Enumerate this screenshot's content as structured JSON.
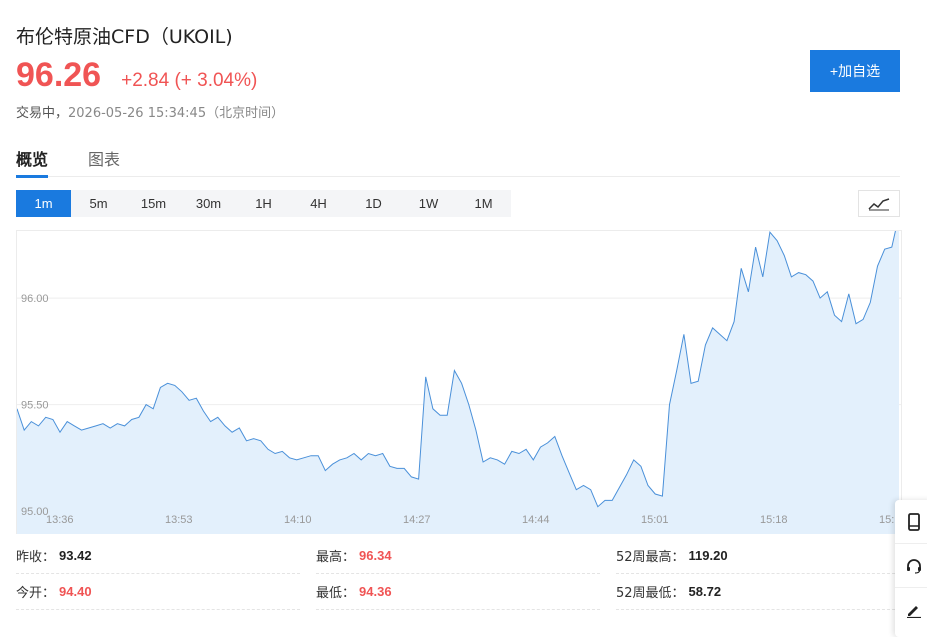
{
  "header": {
    "title": "布伦特原油CFD（UKOIL)",
    "price": "96.26",
    "change": "+2.84  (+ 3.04%)",
    "status_state": "交易中，",
    "status_time": "2026-05-26 15:34:45（北京时间）"
  },
  "actions": {
    "add_watchlist": "+加自选"
  },
  "tabs": [
    {
      "label": "概览",
      "active": true
    },
    {
      "label": "图表",
      "active": false
    }
  ],
  "intervals": [
    {
      "label": "1m",
      "active": true
    },
    {
      "label": "5m",
      "active": false
    },
    {
      "label": "15m",
      "active": false
    },
    {
      "label": "30m",
      "active": false
    },
    {
      "label": "1H",
      "active": false
    },
    {
      "label": "4H",
      "active": false
    },
    {
      "label": "1D",
      "active": false
    },
    {
      "label": "1W",
      "active": false
    },
    {
      "label": "1M",
      "active": false
    }
  ],
  "icons": {
    "chart_type": "line-chart-icon",
    "side": [
      "mobile-icon",
      "headset-icon",
      "pen-icon"
    ]
  },
  "colors": {
    "accent": "#1a7adf",
    "up": "#f05454",
    "line": "#4a90d9",
    "area": "#e3f0fc"
  },
  "chart_data": {
    "type": "area",
    "x_tick_labels": [
      "13:36",
      "13:53",
      "14:10",
      "14:27",
      "14:44",
      "15:01",
      "15:18",
      "15:"
    ],
    "y_tick_labels": [
      "96.00",
      "95.50",
      "95.00"
    ],
    "y_ticks": [
      96.0,
      95.5,
      95.0
    ],
    "ylim": [
      95.0,
      96.4
    ],
    "values": [
      95.48,
      95.38,
      95.42,
      95.4,
      95.44,
      95.43,
      95.37,
      95.42,
      95.4,
      95.38,
      95.39,
      95.4,
      95.41,
      95.39,
      95.41,
      95.4,
      95.43,
      95.44,
      95.5,
      95.48,
      95.58,
      95.6,
      95.59,
      95.56,
      95.52,
      95.53,
      95.47,
      95.42,
      95.44,
      95.4,
      95.37,
      95.39,
      95.33,
      95.34,
      95.33,
      95.29,
      95.27,
      95.28,
      95.25,
      95.24,
      95.25,
      95.26,
      95.26,
      95.19,
      95.22,
      95.24,
      95.25,
      95.27,
      95.24,
      95.27,
      95.26,
      95.27,
      95.21,
      95.2,
      95.2,
      95.16,
      95.15,
      95.63,
      95.48,
      95.45,
      95.45,
      95.66,
      95.6,
      95.5,
      95.38,
      95.23,
      95.25,
      95.24,
      95.22,
      95.28,
      95.27,
      95.29,
      95.24,
      95.3,
      95.32,
      95.35,
      95.26,
      95.18,
      95.1,
      95.12,
      95.1,
      95.02,
      95.05,
      95.05,
      95.11,
      95.17,
      95.24,
      95.21,
      95.12,
      95.08,
      95.07,
      95.5,
      95.66,
      95.83,
      95.6,
      95.61,
      95.78,
      95.86,
      95.83,
      95.8,
      95.89,
      96.14,
      96.03,
      96.24,
      96.1,
      96.31,
      96.27,
      96.2,
      96.1,
      96.12,
      96.11,
      96.08,
      96.0,
      96.03,
      95.92,
      95.89,
      96.02,
      95.88,
      95.9,
      95.98,
      96.15,
      96.23,
      96.24,
      96.39
    ]
  },
  "stats": [
    [
      {
        "label": "昨收：",
        "value": "93.42",
        "red": false
      },
      {
        "label": "最高：",
        "value": "96.34",
        "red": true
      },
      {
        "label": "52周最高：",
        "value": "119.20",
        "red": false
      }
    ],
    [
      {
        "label": "今开：",
        "value": "94.40",
        "red": true
      },
      {
        "label": "最低：",
        "value": "94.36",
        "red": true
      },
      {
        "label": "52周最低：",
        "value": "58.72",
        "red": false
      }
    ]
  ]
}
